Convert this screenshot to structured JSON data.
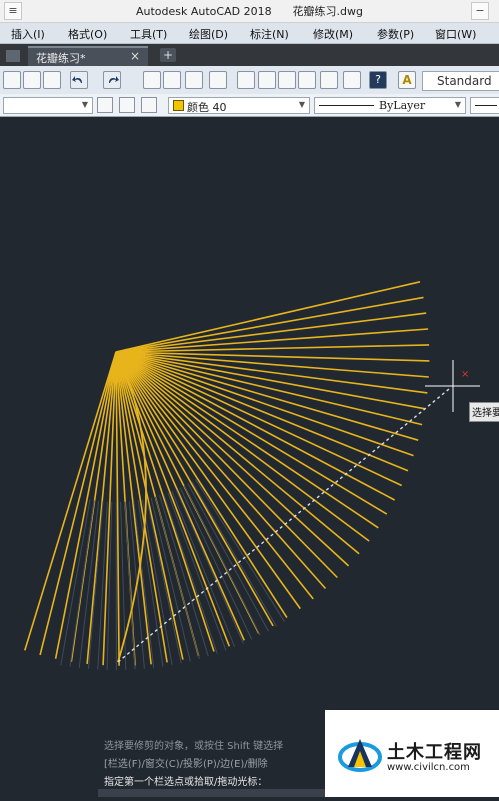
{
  "window": {
    "title": "Autodesk AutoCAD 2018      花瓣练习.dwg",
    "minimize_glyph": "−",
    "system_menu_glyph": "≡"
  },
  "menubar": {
    "items": [
      "插入(I)",
      "格式(O)",
      "工具(T)",
      "绘图(D)",
      "标注(N)",
      "修改(M)",
      "参数(P)",
      "窗口(W)"
    ]
  },
  "tabs": {
    "active": "花瓣练习*",
    "close_glyph": "×",
    "new_tab_glyph": "+"
  },
  "toolbar1": {
    "style_value": "Standard",
    "icons": [
      "drawing-icon",
      "layer-icon",
      "snap-icon",
      "undo-icon",
      "redo-icon",
      "pan-icon",
      "zoom-realtime-icon",
      "zoom-window-icon",
      "zoom-previous-icon",
      "properties-icon",
      "design-center-icon",
      "tool-palette-icon",
      "sheet-set-icon",
      "markup-icon",
      "calculator-icon",
      "help-icon",
      "text-style-icon"
    ]
  },
  "toolbar2": {
    "color_value": "颜色 40",
    "linetype_value": "ByLayer",
    "color_swatch": "#f5c400"
  },
  "canvas": {
    "background": "#212830",
    "line_color": "#e8b41c",
    "fence_line_color": "#d9dde2",
    "crosshair_color": "#ffffff",
    "pickbox_marker_color": "#e0352b"
  },
  "tooltip": {
    "text": "选择要"
  },
  "command_line": {
    "history1": "选择要修剪的对象，或按住 Shift 键选择",
    "history2": "[栏选(F)/窗交(C)/投影(P)/边(E)/删除",
    "prompt": "指定第一个栏选点或拾取/拖动光标："
  },
  "watermark": {
    "name": "土木工程网",
    "url": "www.civilcn.com"
  }
}
